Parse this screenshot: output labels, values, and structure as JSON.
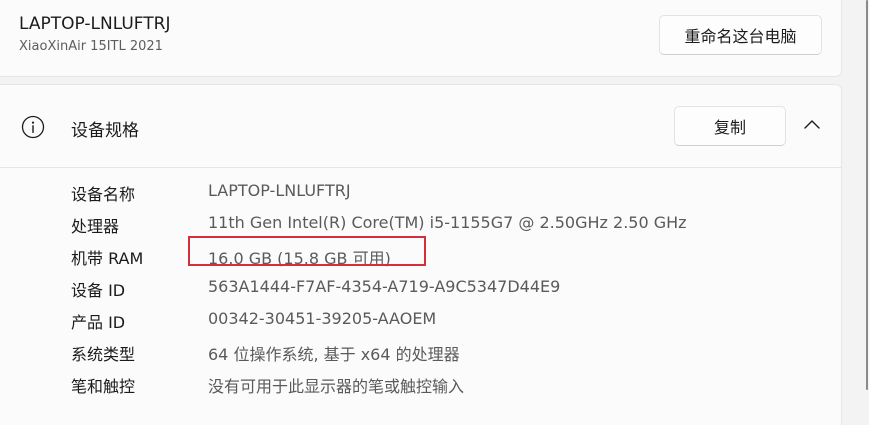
{
  "device": {
    "name": "LAPTOP-LNLUFTRJ",
    "model": "XiaoXinAir 15ITL 2021",
    "rename_label": "重命名这台电脑"
  },
  "specs": {
    "title": "设备规格",
    "copy_label": "复制",
    "icon": "info-icon",
    "expanded_icon": "chevron-up-icon",
    "rows": [
      {
        "label": "设备名称",
        "value": "LAPTOP-LNLUFTRJ"
      },
      {
        "label": "处理器",
        "value": "11th Gen Intel(R) Core(TM) i5-1155G7 @ 2.50GHz   2.50 GHz"
      },
      {
        "label": "机带 RAM",
        "value": "16.0 GB (15.8 GB 可用)"
      },
      {
        "label": "设备 ID",
        "value": "563A1444-F7AF-4354-A719-A9C5347D44E9"
      },
      {
        "label": "产品 ID",
        "value": "00342-30451-39205-AAOEM"
      },
      {
        "label": "系统类型",
        "value": "64 位操作系统, 基于 x64 的处理器"
      },
      {
        "label": "笔和触控",
        "value": "没有可用于此显示器的笔或触控输入"
      }
    ]
  },
  "colors": {
    "highlight": "#d32f3a",
    "page_background": "#f3f3f3",
    "card_background": "#fbfbfb"
  }
}
